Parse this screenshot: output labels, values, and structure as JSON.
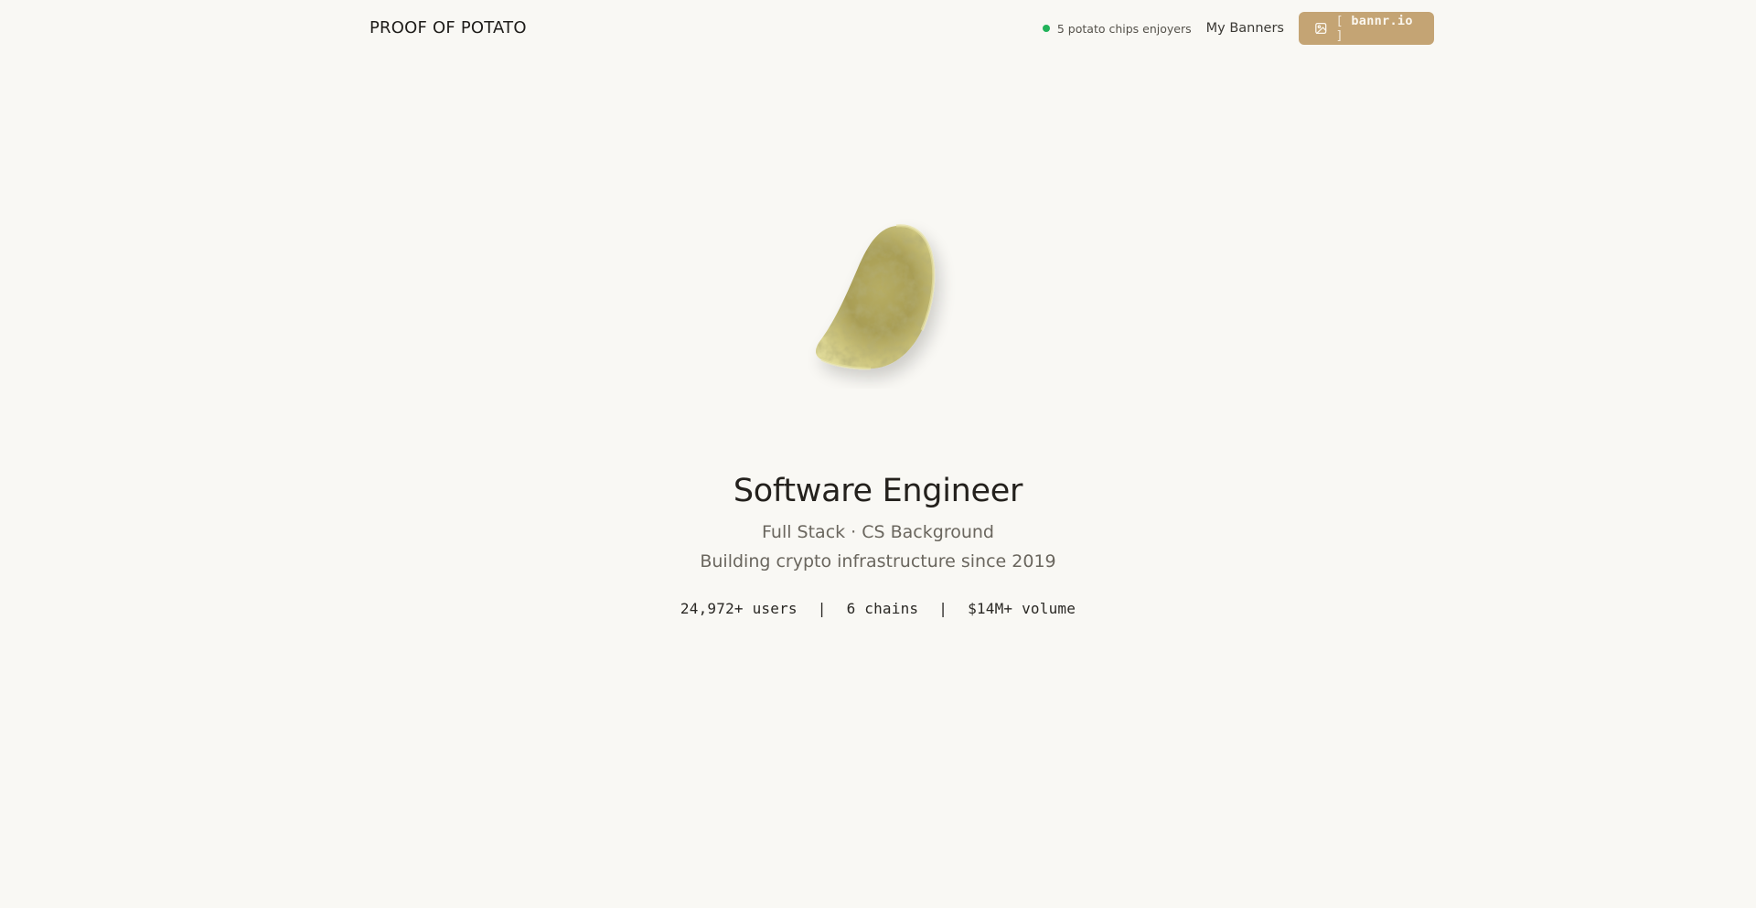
{
  "header": {
    "brand": "PROOF OF POTATO",
    "status_text": "5 potato chips enjoyers",
    "nav_link": "My Banners",
    "cta_open": "[",
    "cta_label": "bannr.io",
    "cta_close": "]"
  },
  "hero": {
    "title": "Software Engineer",
    "subtitle_1": "Full Stack · CS Background",
    "subtitle_2": "Building crypto infrastructure since 2019",
    "stats": [
      "24,972+ users",
      "6 chains",
      "$14M+ volume"
    ],
    "separator": "|"
  },
  "colors": {
    "background": "#f9f8f4",
    "accent": "#c4a474",
    "status_dot": "#22b35a"
  },
  "icons": {
    "cta_icon": "image-icon",
    "status_icon": "online-dot"
  }
}
